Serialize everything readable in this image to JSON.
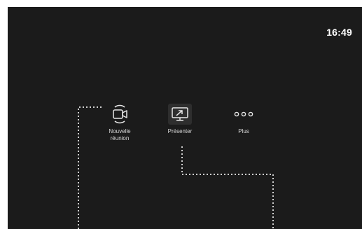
{
  "status": {
    "time": "16:49"
  },
  "actions": [
    {
      "label": "Nouvelle\nréunion",
      "icon": "video-camera-icon"
    },
    {
      "label": "Présenter",
      "icon": "screen-share-icon"
    },
    {
      "label": "Plus",
      "icon": "more-dots-icon"
    }
  ],
  "colors": {
    "background": "#1b1b1b",
    "text": "#ffffff",
    "guide": "#cfcfcf"
  }
}
